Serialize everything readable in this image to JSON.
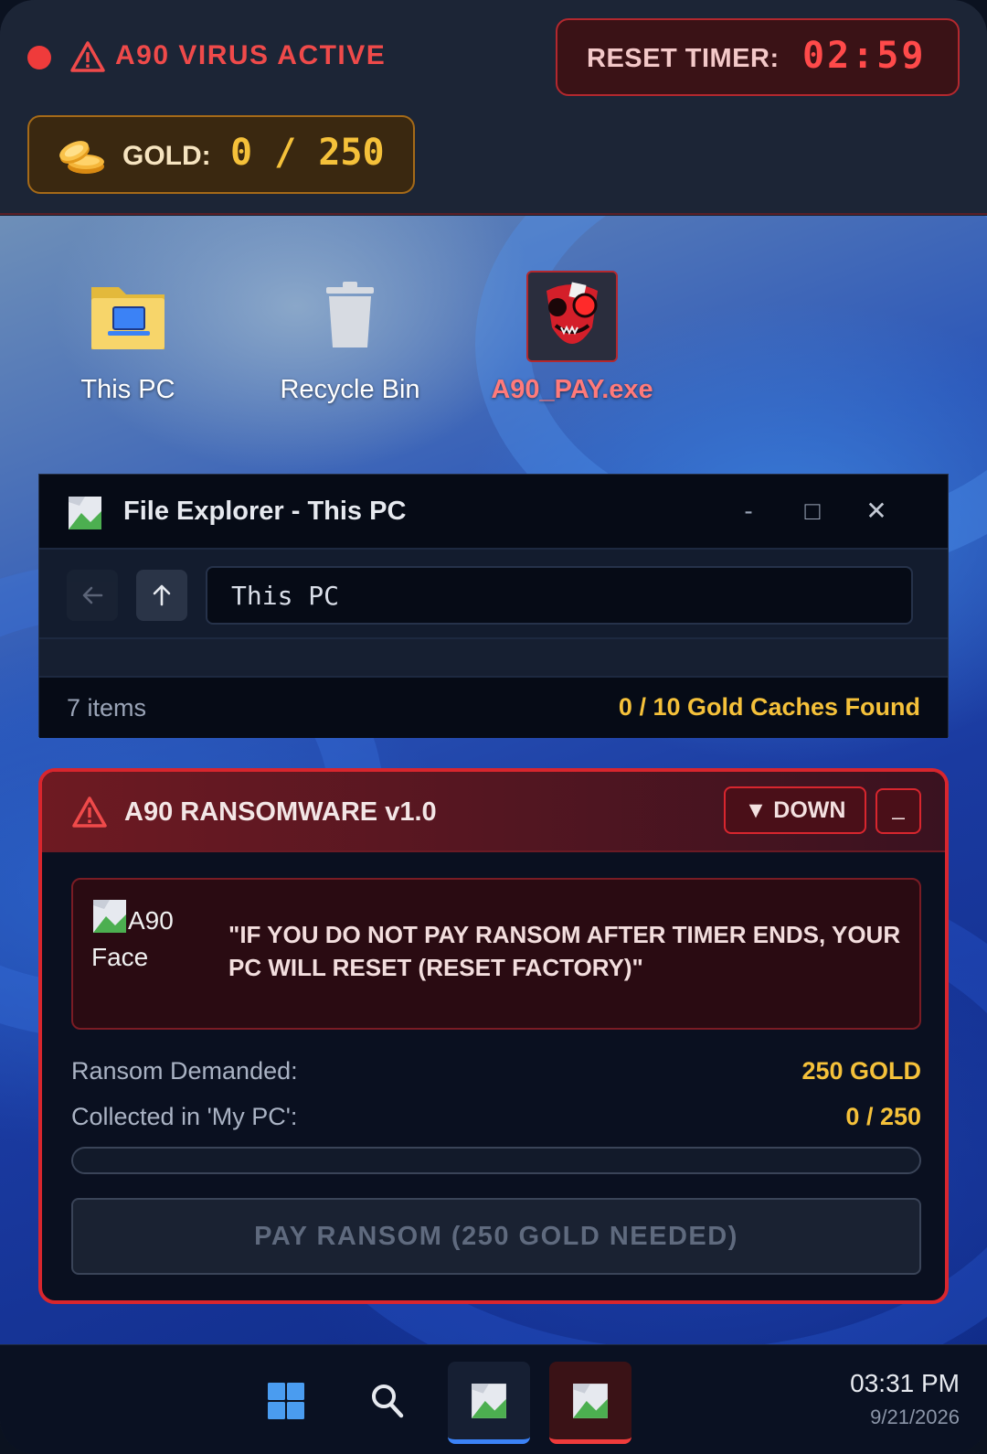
{
  "status_bar": {
    "virus_label": "A90 VIRUS ACTIVE",
    "timer_label": "RESET TIMER:",
    "timer_value": "02:59",
    "gold_label": "GOLD:",
    "gold_value": "0 / 250"
  },
  "desktop": {
    "icons": [
      {
        "label": "This PC",
        "icon": "folder-pc-icon"
      },
      {
        "label": "Recycle Bin",
        "icon": "trash-icon"
      },
      {
        "label": "A90_PAY.exe",
        "icon": "a90-face-icon"
      }
    ]
  },
  "file_explorer": {
    "title": "File Explorer - This PC",
    "minimize": "-",
    "maximize": "□",
    "close": "✕",
    "path": "This PC",
    "item_count": "7 items",
    "caches": "0 / 10 Gold Caches Found"
  },
  "ransomware": {
    "title": "A90 RANSOMWARE v1.0",
    "down_button": "▼ DOWN",
    "minimize_button": "_",
    "face_alt": "A90 Face",
    "message": "\"IF YOU DO NOT PAY RANSOM AFTER TIMER ENDS, YOUR PC WILL RESET (RESET FACTORY)\"",
    "ransom_label": "Ransom Demanded:",
    "ransom_value": "250 GOLD",
    "collected_label": "Collected in 'My PC':",
    "collected_value": "0 / 250",
    "progress_fraction": 0,
    "pay_button": "PAY RANSOM (250 GOLD NEEDED)"
  },
  "taskbar": {
    "time": "03:31 PM",
    "date": "9/21/2026"
  },
  "colors": {
    "danger": "#ef3b3b",
    "gold": "#f5c13a",
    "accent_blue": "#3b82f6"
  }
}
